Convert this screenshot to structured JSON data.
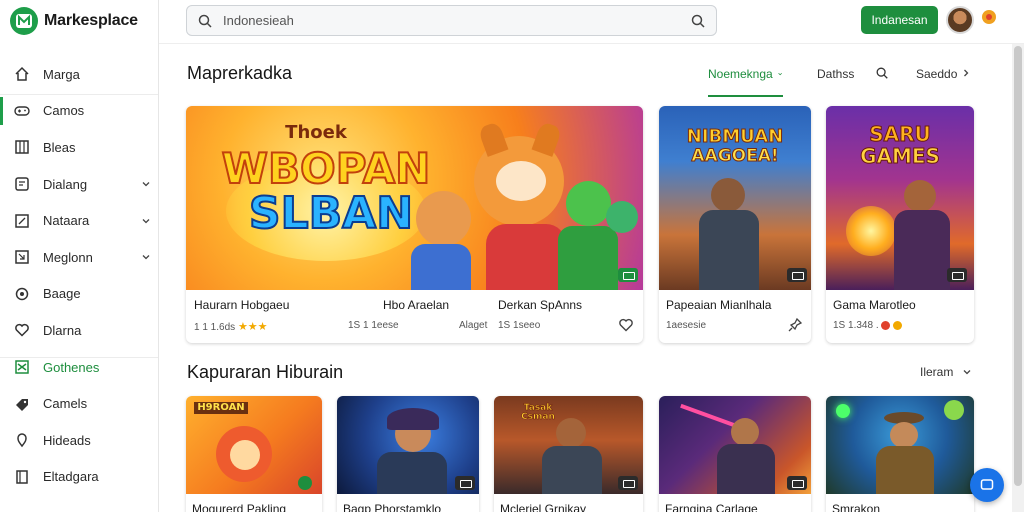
{
  "brand": {
    "name": "Markesplace"
  },
  "search": {
    "value": "Indonesieah"
  },
  "topbar": {
    "button_label": "Indanesan"
  },
  "sidebar": {
    "items": [
      {
        "label": "Marga",
        "icon": "home-icon"
      },
      {
        "label": "Camos",
        "icon": "gamepad-icon"
      },
      {
        "label": "Bleas",
        "icon": "grid-icon"
      },
      {
        "label": "Dialang",
        "icon": "chat-icon"
      },
      {
        "label": "Nataara",
        "icon": "tag-icon"
      },
      {
        "label": "Meglonn",
        "icon": "crop-icon"
      },
      {
        "label": "Baage",
        "icon": "settings-icon"
      },
      {
        "label": "Dlarna",
        "icon": "heart-icon"
      },
      {
        "label": "Gothenes",
        "icon": "shuffle-icon"
      },
      {
        "label": "Camels",
        "icon": "tag-filled-icon"
      },
      {
        "label": "Hideads",
        "icon": "pin-icon"
      },
      {
        "label": "Eltadgara",
        "icon": "book-icon"
      }
    ]
  },
  "section1": {
    "title": "Maprerkadka",
    "sort_label": "Noemeknga",
    "link1": "Dathss",
    "link2": "Saeddo"
  },
  "featured": {
    "hero": {
      "art_line1": "Thoek",
      "art_line2": "WBOPAN",
      "art_line3": "SLBAN",
      "items": [
        {
          "title": "Haurarn Hobgaeu",
          "meta": "1 1 1.6ds"
        },
        {
          "title": "Hbo Araelan",
          "meta": "1S 1 1eese"
        },
        {
          "title": "Derkan SpAnns",
          "meta": "1S 1seeo"
        }
      ],
      "extra_label": "Alaget"
    },
    "cards": [
      {
        "art_line1": "NIBMUAN",
        "art_line2": "AAGOEA!",
        "title": "Papeaian Mianlhala",
        "meta": "1aesesie"
      },
      {
        "art_line1": "SARU",
        "art_line2": "GAMES",
        "title": "Gama Marotleo",
        "meta": "1S 1.348 ."
      }
    ]
  },
  "section2": {
    "title": "Kapuraran Hiburain",
    "link": "Ileram",
    "cards": [
      {
        "art_line1": "H9ROAN",
        "title": "Mogurerd Pakling"
      },
      {
        "art_line1": "",
        "title": "Bagp Phorstamklo"
      },
      {
        "art_line1": "Tasak Csman",
        "title": "Mcleriel Grnikay"
      },
      {
        "art_line1": "",
        "title": "Farngina Carlage"
      },
      {
        "art_line1": "",
        "title": "Smrakon"
      }
    ]
  },
  "colors": {
    "accent_green": "#1e8e3e",
    "fab_blue": "#1a73e8",
    "star": "#f2a900"
  }
}
